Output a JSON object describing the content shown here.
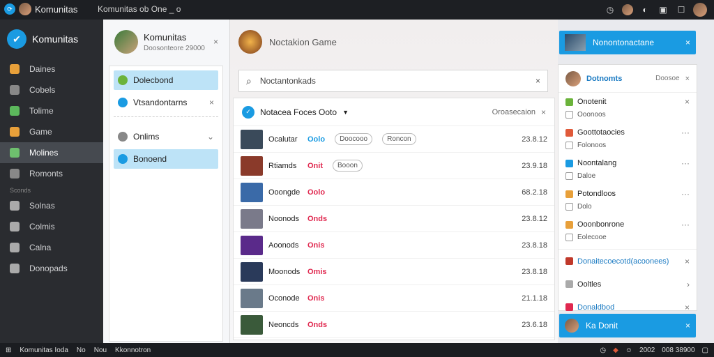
{
  "topbar": {
    "app_title": "Komunitas",
    "breadcrumb": "Komunitas ob One _ o"
  },
  "sidebar": {
    "brand": "Komunitas",
    "items": [
      {
        "label": "Daines",
        "color": "#e8a03a",
        "icon": "gear-icon"
      },
      {
        "label": "Cobels",
        "color": "#888",
        "icon": "home-icon"
      },
      {
        "label": "Tolime",
        "color": "#5cb85c",
        "icon": "check-icon"
      },
      {
        "label": "Game",
        "color": "#e8a03a",
        "icon": "gamepad-icon"
      },
      {
        "label": "Molines",
        "color": "#6ec06e",
        "icon": "tag-icon",
        "active": true
      },
      {
        "label": "Romonts",
        "color": "#888",
        "icon": "chat-icon"
      }
    ],
    "section": "Sconds",
    "items2": [
      {
        "label": "Solnas",
        "color": "#aaa",
        "icon": "grid-icon"
      },
      {
        "label": "Colmis",
        "color": "#aaa",
        "icon": "search-icon"
      },
      {
        "label": "Calna",
        "color": "#aaa",
        "icon": "home-icon"
      },
      {
        "label": "Donopads",
        "color": "#aaa",
        "icon": "doc-icon"
      }
    ]
  },
  "panel1": {
    "title": "Komunitas",
    "subtitle": "Doosonteore 29000",
    "rows": [
      {
        "label": "Dolecbond",
        "color": "#6bb33b",
        "sel": true
      },
      {
        "label": "Vtsandontarns",
        "color": "#1a9be2",
        "sel": false,
        "closable": true
      },
      {
        "label": "Onlims",
        "color": "#888",
        "sel": false,
        "chevron": true
      },
      {
        "label": "Bonoend",
        "color": "#1a9be2",
        "sel": true
      }
    ]
  },
  "main": {
    "title": "Noctakion Game",
    "search_value": "Noctantonkads",
    "list_title": "Notacea Foces Ooto",
    "list_action": "Oroasecaion",
    "rows": [
      {
        "name": "Ocalutar",
        "tag": "Oolo",
        "tag_color": "#1a9be2",
        "pills": [
          "Doocooo",
          "Roncon"
        ],
        "time": "23.8.12",
        "thumb": "#3a4a5a"
      },
      {
        "name": "Rtiamds",
        "tag": "Onit",
        "tag_color": "#e0284f",
        "pills": [
          "Booon"
        ],
        "time": "23.9.18",
        "thumb": "#8a3a2a"
      },
      {
        "name": "Ooongde",
        "tag": "Oolo",
        "tag_color": "#e0284f",
        "pills": [],
        "time": "68.2.18",
        "thumb": "#3a6aa8"
      },
      {
        "name": "Noonods",
        "tag": "Onds",
        "tag_color": "#e0284f",
        "pills": [],
        "time": "23.8.12",
        "thumb": "#7a7a8a"
      },
      {
        "name": "Aoonods",
        "tag": "Onis",
        "tag_color": "#e0284f",
        "pills": [],
        "time": "23.8.18",
        "thumb": "#5a2a8a"
      },
      {
        "name": "Moonods",
        "tag": "Omis",
        "tag_color": "#e0284f",
        "pills": [],
        "time": "23.8.18",
        "thumb": "#2a3a5a"
      },
      {
        "name": "Oconode",
        "tag": "Onis",
        "tag_color": "#e0284f",
        "pills": [],
        "time": "21.1.18",
        "thumb": "#6a7a8a"
      },
      {
        "name": "Neoncds",
        "tag": "Onds",
        "tag_color": "#e0284f",
        "pills": [],
        "time": "23.6.18",
        "thumb": "#3a5a3a"
      }
    ]
  },
  "right": {
    "toast_top": "Nonontonactane",
    "card_title": "Dotnomts",
    "card_sub": "Doosoe",
    "items": [
      {
        "title": "Onotenit",
        "sub": "Ooonoos",
        "color": "#6bb33b",
        "action": "×"
      },
      {
        "title": "Goottotaocies",
        "sub": "Folonoos",
        "color": "#e05a3a",
        "action": "···"
      },
      {
        "title": "Noontalang",
        "sub": "Daloe",
        "color": "#1a9be2",
        "action": "···"
      },
      {
        "title": "Potondloos",
        "sub": "Dolo",
        "color": "#e8a03a",
        "action": "···"
      },
      {
        "title": "Ooonbonrone",
        "sub": "Eolecooe",
        "color": "#e8a03a",
        "action": "···"
      }
    ],
    "bottom": [
      {
        "label": "Donaitecoecotd(acoonees)",
        "color": "#c0392b",
        "action": "×"
      },
      {
        "label": "Ooltles",
        "color": "#aaa",
        "action": "›"
      },
      {
        "label": "Donaldbod",
        "color": "#e0284f",
        "action": "×"
      }
    ],
    "toast_bottom": "Ka Donit"
  },
  "statusbar": {
    "left": "Komunitas Ioda",
    "mid1": "No",
    "mid2": "Nou",
    "mid3": "Kkonnotron",
    "right1": "2002",
    "right2": "008 38900"
  }
}
